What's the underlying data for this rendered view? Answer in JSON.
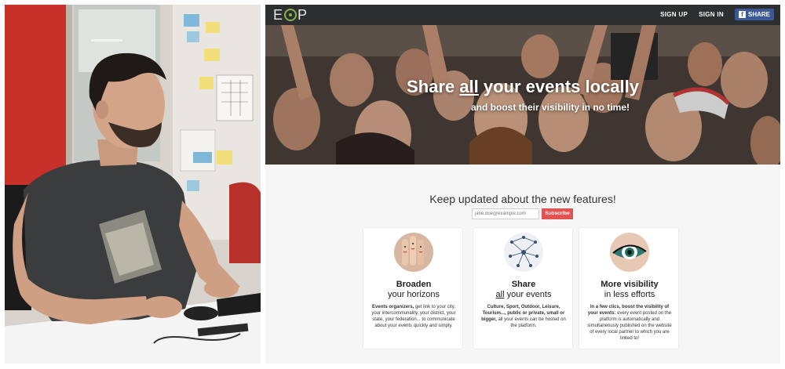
{
  "header": {
    "logo_text": "EOP",
    "sign_up": "SIGN UP",
    "sign_in": "SIGN IN",
    "share_label": "SHARE",
    "fb_letter": "f"
  },
  "hero": {
    "title_pre": "Share ",
    "title_underlined": "all",
    "title_post": " your events locally",
    "subtitle": "and boost their visibility in no time!"
  },
  "newsletter": {
    "title": "Keep updated about the new features!",
    "email_placeholder": "jane.doe@example.com",
    "subscribe_label": "Subscribe"
  },
  "features": [
    {
      "title_line1": "Broaden",
      "title_line2": "your horizons",
      "desc_bold": "Events organizers,",
      "desc_rest": " get link to your city, your intercommunality, your district, your state, your federation... to communicate about your events quickly and simply."
    },
    {
      "title_line1": "Share",
      "title_line2_underlined": "all",
      "title_line2_rest": " your events",
      "desc_bold": "Culture, Sport, Outdoor, Leisure, Tourism..., public or private, small or bigger,",
      "desc_rest": " all your events can be hosted on the platform."
    },
    {
      "title_line1": "More visibility",
      "title_line2": "in less efforts",
      "desc_bold": "In a few clics, boost the visibility of your events:",
      "desc_rest": " every event posted on the platform is automatically and simultaneously published on the website of every local partner to which you are linked to!"
    }
  ],
  "colors": {
    "topbar": "#2d2e30",
    "logo_accent": "#86b44a",
    "facebook": "#3b5998",
    "subscribe": "#e15454"
  }
}
